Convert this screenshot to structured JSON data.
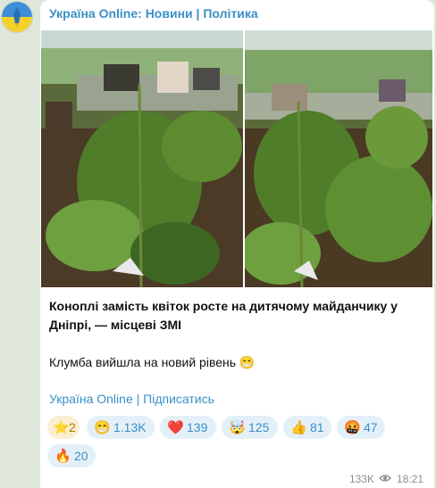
{
  "channel": {
    "title": "Україна Online: Новини | Політика"
  },
  "post": {
    "headline": "Коноплі замість квіток росте на дитячому майданчику у Дніпрі, — місцеві ЗМІ",
    "body": "Клумба вийшла на новий рівень 😁",
    "footer": {
      "channel_link": "Україна Online",
      "separator": " | ",
      "subscribe_link": "Підписатись"
    }
  },
  "reactions": [
    {
      "emoji": "⭐",
      "count": "2",
      "paid": true
    },
    {
      "emoji": "😁",
      "count": "1.13K"
    },
    {
      "emoji": "❤️",
      "count": "139"
    },
    {
      "emoji": "🤯",
      "count": "125"
    },
    {
      "emoji": "👍",
      "count": "81"
    },
    {
      "emoji": "🤬",
      "count": "47"
    },
    {
      "emoji": "🔥",
      "count": "20"
    }
  ],
  "meta": {
    "views": "133K",
    "time": "18:21",
    "views_icon": "eye-icon"
  },
  "colors": {
    "accent": "#3a8fc7",
    "reaction_bg": "#e4f0f8",
    "paid_bg": "#fbefd3"
  }
}
